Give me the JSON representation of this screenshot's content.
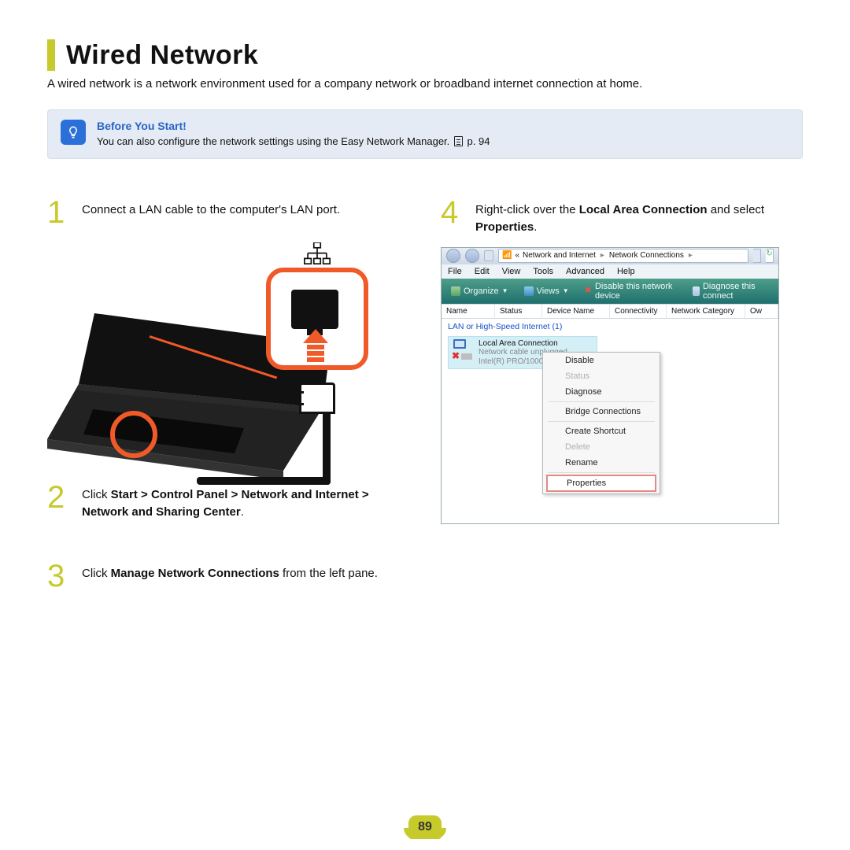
{
  "title": "Wired Network",
  "subtitle": "A wired network is a network environment used for a company network or broadband internet connection at home.",
  "info": {
    "heading": "Before You Start!",
    "text_pre": "You can also configure the network settings using the Easy Network Manager. ",
    "page_ref": "p. 94"
  },
  "steps": {
    "s1_num": "1",
    "s1_text": "Connect a LAN cable to the computer's LAN port.",
    "s2_num": "2",
    "s2_a": "Click ",
    "s2_b": "Start > Control Panel > Network and Internet > Network and Sharing Center",
    "s2_c": ".",
    "s3_num": "3",
    "s3_a": "Click ",
    "s3_b": "Manage Network Connections",
    "s3_c": " from the left pane.",
    "s4_num": "4",
    "s4_a": "Right-click over the ",
    "s4_b": "Local Area Connection",
    "s4_c": " and select ",
    "s4_d": "Properties",
    "s4_e": "."
  },
  "win": {
    "crumb_prefix": "«",
    "crumb_a": "Network and Internet",
    "crumb_b": "Network Connections",
    "crumb_sep": "▸",
    "menus": [
      "File",
      "Edit",
      "View",
      "Tools",
      "Advanced",
      "Help"
    ],
    "toolbar": {
      "organize": "Organize",
      "views": "Views",
      "disable": "Disable this network device",
      "diagnose": "Diagnose this connect"
    },
    "columns": {
      "name": "Name",
      "status": "Status",
      "device": "Device Name",
      "conn": "Connectivity",
      "cat": "Network Category",
      "own": "Ow"
    },
    "group": "LAN or High-Speed Internet (1)",
    "conn": {
      "name": "Local Area Connection",
      "status": "Network cable unplugged",
      "device": "Intel(R) PRO/1000"
    },
    "ctx": {
      "disable": "Disable",
      "status": "Status",
      "diagnose": "Diagnose",
      "bridge": "Bridge Connections",
      "shortcut": "Create Shortcut",
      "delete": "Delete",
      "rename": "Rename",
      "props": "Properties"
    }
  },
  "page_number": "89"
}
